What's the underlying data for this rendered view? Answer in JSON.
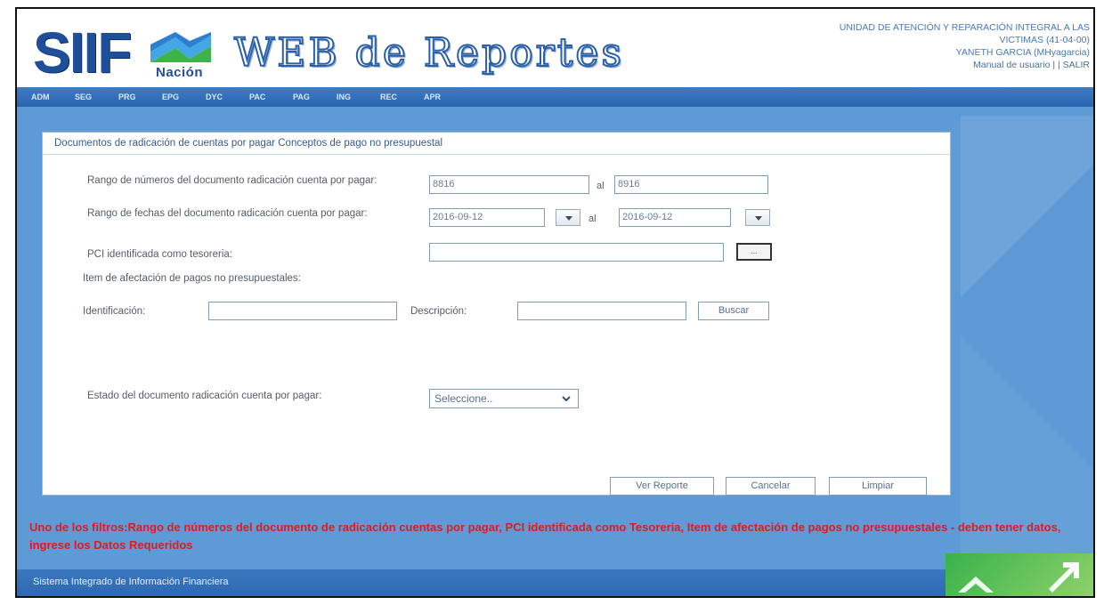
{
  "header": {
    "logo_siif": "SIIF",
    "logo_nacion": "Nación",
    "logo_title": "WEB de Reportes",
    "entity_line1": "UNIDAD DE ATENCIÓN Y REPARACIÓN INTEGRAL A LAS",
    "entity_line2": "VICTIMAS (41-04-00)",
    "user": "YANETH GARCIA (MHyagarcia)",
    "manual_label": "Manual de usuario",
    "separator": "| |",
    "exit_label": "SALIR"
  },
  "nav": {
    "items": [
      "ADM",
      "SEG",
      "PRG",
      "EPG",
      "DYC",
      "PAC",
      "PAG",
      "ING",
      "REC",
      "APR"
    ]
  },
  "form": {
    "title": "Documentos de radicación de cuentas por pagar Conceptos de pago no presupuestal",
    "range_numbers_label": "Rango de números del documento radicación cuenta por pagar:",
    "range_numbers_from": "8816",
    "range_to_label": "al",
    "range_numbers_to": "8916",
    "range_dates_label": "Rango de fechas del documento radicación cuenta por pagar:",
    "date_from": "2016-09-12",
    "date_to": "2016-09-12",
    "pci_label": "PCI identificada como tesoreria:",
    "pci_value": "",
    "pci_button": "...",
    "item_label": "Item de afectación de pagos no presupuestales:",
    "identificacion_label": "Identificación:",
    "identificacion_value": "",
    "descripcion_label": "Descripción:",
    "descripcion_value": "",
    "buscar_button": "Buscar",
    "estado_label": "Estado del documento radicación cuenta por pagar:",
    "estado_selected": "Seleccione..",
    "ver_reporte_button": "Ver Reporte",
    "cancelar_button": "Cancelar",
    "limpiar_button": "Limpiar"
  },
  "error": {
    "message": "Uno de los filtros:Rango de números del documento de radicación cuentas por pagar, PCI identificada como Tesoreria, Item de afectación de pagos no presupuestales - deben tener datos, ingrese los Datos Requeridos"
  },
  "footer": {
    "text": "Sistema Integrado de Información Financiera"
  },
  "colors": {
    "background_blue": "#5d9ad6",
    "error_red": "#e01b1b",
    "brand_blue": "#1f4e9a",
    "logo_green": "#38b24a"
  },
  "icons": {
    "date_dropdown": "chevron-down-icon",
    "estado_dropdown": "chevron-down-icon",
    "flag_logo": "siif-flag-icon"
  }
}
